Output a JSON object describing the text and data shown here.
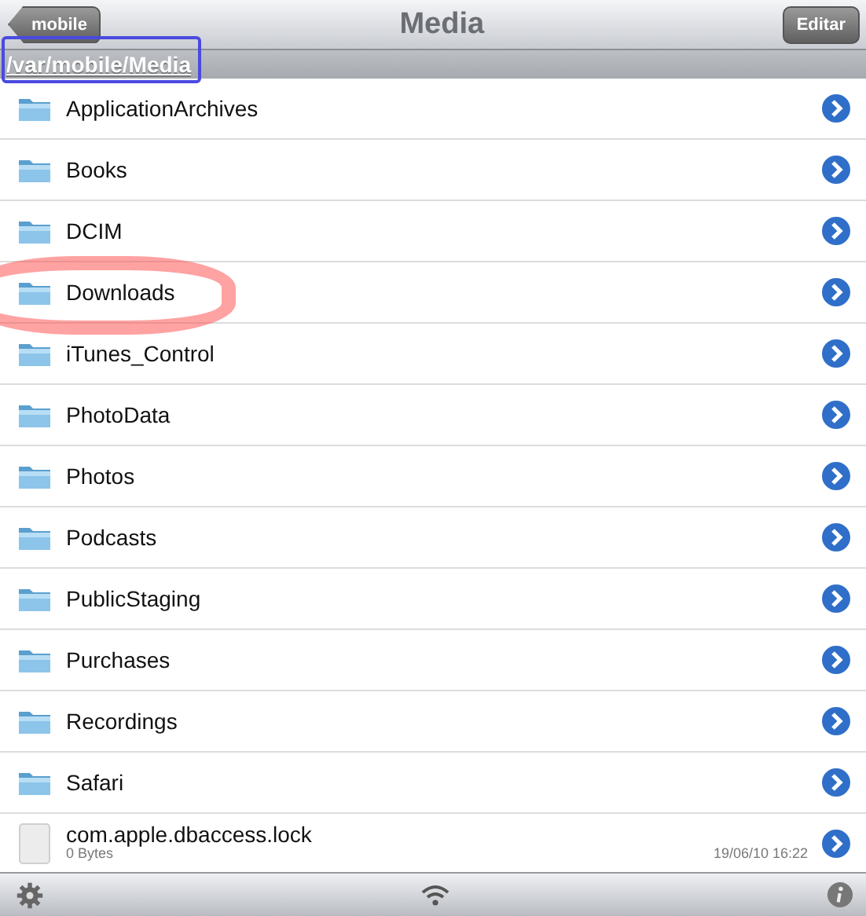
{
  "nav_bar": {
    "back_button": "mobile",
    "title": "Media",
    "edit_button": "Editar"
  },
  "path_bar": {
    "path": "/var/mobile/Media"
  },
  "items": [
    {
      "kind": "folder",
      "name": "ApplicationArchives"
    },
    {
      "kind": "folder",
      "name": "Books"
    },
    {
      "kind": "folder",
      "name": "DCIM"
    },
    {
      "kind": "folder",
      "name": "Downloads"
    },
    {
      "kind": "folder",
      "name": "iTunes_Control"
    },
    {
      "kind": "folder",
      "name": "PhotoData"
    },
    {
      "kind": "folder",
      "name": "Photos"
    },
    {
      "kind": "folder",
      "name": "Podcasts"
    },
    {
      "kind": "folder",
      "name": "PublicStaging"
    },
    {
      "kind": "folder",
      "name": "Purchases"
    },
    {
      "kind": "folder",
      "name": "Recordings"
    },
    {
      "kind": "folder",
      "name": "Safari"
    },
    {
      "kind": "file",
      "name": "com.apple.dbaccess.lock",
      "size": "0 Bytes",
      "date": "19/06/10 16:22"
    }
  ]
}
